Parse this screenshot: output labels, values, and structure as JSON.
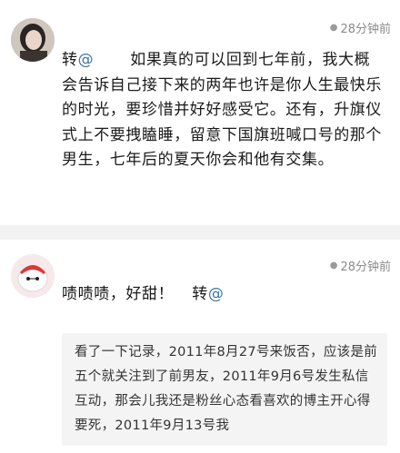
{
  "comments": [
    {
      "time": "28分钟前",
      "repost_prefix": "转",
      "mention": "@",
      "text": "如果真的可以回到七年前，我大概会告诉自己接下来的两年也许是你人生最快乐的时光，要珍惜并好好感受它。还有，升旗仪式上不要拽瞌睡，留意下国旗班喊口号的那个男生，七年后的夏天你会和他有交集。"
    },
    {
      "time": "28分钟前",
      "text": "啧啧啧，好甜！",
      "repost_prefix": "转",
      "mention": "@",
      "quote": "看了一下记录，2011年8月27号来饭否，应该是前五个就关注到了前男友，2011年9月6号发生私信互动，那会儿我还是粉丝心态看喜欢的博主开心得要死，2011年9月13号我"
    }
  ],
  "colors": {
    "mention": "#3d74a6",
    "time": "#8a8a8a"
  },
  "icons": {
    "avatar1": "girl-photo-avatar",
    "avatar2": "white-robot-avatar",
    "time_dot": "dot-icon"
  }
}
